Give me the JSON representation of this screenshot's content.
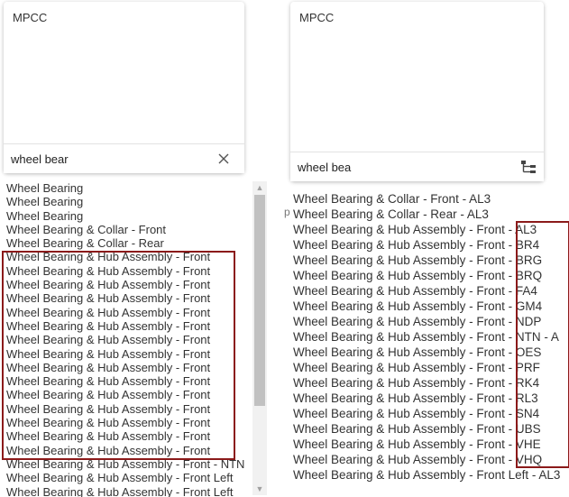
{
  "left_panel": {
    "tag": "MPCC",
    "search_value": "wheel bear",
    "items": [
      "Wheel Bearing",
      "Wheel Bearing",
      "Wheel Bearing",
      "Wheel Bearing & Collar - Front",
      "Wheel Bearing & Collar - Rear",
      "Wheel Bearing & Hub Assembly - Front",
      "Wheel Bearing & Hub Assembly - Front",
      "Wheel Bearing & Hub Assembly - Front",
      "Wheel Bearing & Hub Assembly - Front",
      "Wheel Bearing & Hub Assembly - Front",
      "Wheel Bearing & Hub Assembly - Front",
      "Wheel Bearing & Hub Assembly - Front",
      "Wheel Bearing & Hub Assembly - Front",
      "Wheel Bearing & Hub Assembly - Front",
      "Wheel Bearing & Hub Assembly - Front",
      "Wheel Bearing & Hub Assembly - Front",
      "Wheel Bearing & Hub Assembly - Front",
      "Wheel Bearing & Hub Assembly - Front",
      "Wheel Bearing & Hub Assembly - Front",
      "Wheel Bearing & Hub Assembly - Front",
      "Wheel Bearing & Hub Assembly - Front - NTN",
      "Wheel Bearing & Hub Assembly - Front Left",
      "Wheel Bearing & Hub Assembly - Front Left"
    ]
  },
  "right_panel": {
    "tag": "MPCC",
    "search_value": "wheel bea",
    "items": [
      "Wheel Bearing & Collar - Front - AL3",
      "Wheel Bearing & Collar - Rear - AL3",
      "Wheel Bearing & Hub Assembly - Front - AL3",
      "Wheel Bearing & Hub Assembly - Front - BR4",
      "Wheel Bearing & Hub Assembly - Front - BRG",
      "Wheel Bearing & Hub Assembly - Front - BRQ",
      "Wheel Bearing & Hub Assembly - Front - FA4",
      "Wheel Bearing & Hub Assembly - Front - GM4",
      "Wheel Bearing & Hub Assembly - Front - NDP",
      "Wheel Bearing & Hub Assembly - Front - NTN - A",
      "Wheel Bearing & Hub Assembly - Front - OES",
      "Wheel Bearing & Hub Assembly - Front - PRF",
      "Wheel Bearing & Hub Assembly - Front - RK4",
      "Wheel Bearing & Hub Assembly - Front - RL3",
      "Wheel Bearing & Hub Assembly - Front - SN4",
      "Wheel Bearing & Hub Assembly - Front - UBS",
      "Wheel Bearing & Hub Assembly - Front - VHE",
      "Wheel Bearing & Hub Assembly - Front - VHQ",
      "Wheel Bearing & Hub Assembly - Front Left - AL3"
    ]
  },
  "colors": {
    "highlight": "#8b1a1a",
    "text": "#333333"
  }
}
